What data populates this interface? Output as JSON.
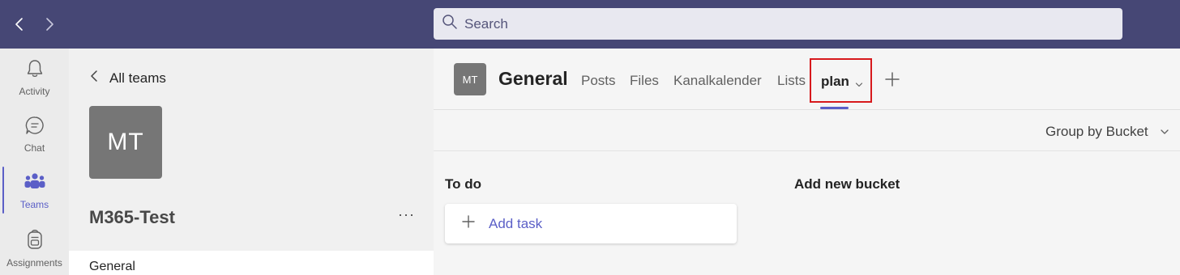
{
  "topbar": {
    "search_placeholder": "Search"
  },
  "rail": {
    "items": [
      {
        "label": "Activity",
        "icon": "bell-icon"
      },
      {
        "label": "Chat",
        "icon": "chat-bubble-icon"
      },
      {
        "label": "Teams",
        "icon": "teams-icon",
        "active": true
      },
      {
        "label": "Assignments",
        "icon": "backpack-icon"
      }
    ]
  },
  "team_panel": {
    "all_teams_label": "All teams",
    "avatar_initials": "MT",
    "team_name": "M365-Test",
    "more_label": "···",
    "channels": [
      {
        "label": "General",
        "selected": true
      }
    ]
  },
  "channel": {
    "avatar_initials": "MT",
    "title": "General",
    "tabs": [
      {
        "label": "Posts"
      },
      {
        "label": "Files"
      },
      {
        "label": "Kanalkalender"
      },
      {
        "label": "Lists"
      },
      {
        "label": "plan",
        "active": true,
        "highlighted": true
      }
    ]
  },
  "toolbar": {
    "group_by_label": "Group by Bucket"
  },
  "board": {
    "bucket_title": "To do",
    "add_task_label": "Add task",
    "add_bucket_label": "Add new bucket"
  },
  "colors": {
    "topbar_bg": "#464775",
    "accent": "#5b5fc7",
    "highlight_box": "#d7191c"
  }
}
